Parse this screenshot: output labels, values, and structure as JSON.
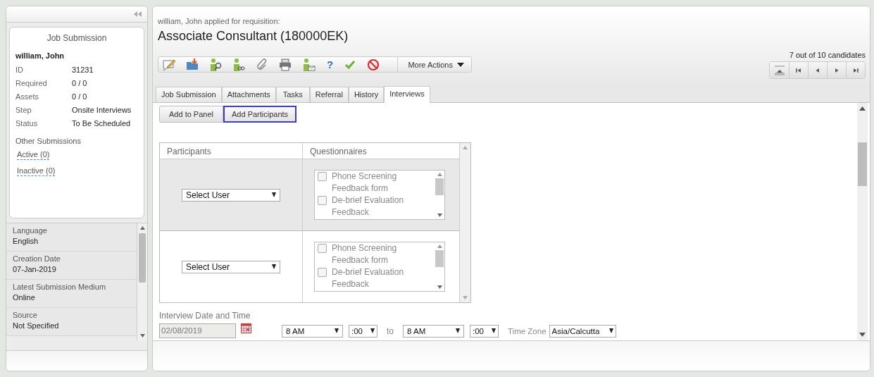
{
  "sidebar": {
    "card": {
      "title": "Job Submission",
      "candidate": "william, John",
      "fields": [
        {
          "label": "ID",
          "value": "31231"
        },
        {
          "label": "Required",
          "value": "0 / 0"
        },
        {
          "label": "Assets",
          "value": "0 / 0"
        },
        {
          "label": "Step",
          "value": "Onsite Interviews"
        },
        {
          "label": "Status",
          "value": "To Be Scheduled"
        }
      ],
      "other_title": "Other Submissions",
      "links": [
        "Active (0)",
        "Inactive (0)"
      ]
    },
    "details": [
      {
        "label": "Language",
        "value": "English"
      },
      {
        "label": "Creation Date",
        "value": "07-Jan-2019"
      },
      {
        "label": "Latest Submission Medium",
        "value": "Online"
      },
      {
        "label": "Source",
        "value": "Not Specified"
      }
    ]
  },
  "header": {
    "subtitle": "william, John applied for requisition:",
    "title": "Associate Consultant (180000EK)",
    "count": "7 out of 10 candidates"
  },
  "toolbar": {
    "help_glyph": "?",
    "more_actions": "More Actions"
  },
  "tabs": [
    {
      "label": "Job Submission",
      "selected": false
    },
    {
      "label": "Attachments",
      "selected": false
    },
    {
      "label": "Tasks",
      "selected": false
    },
    {
      "label": "Referral",
      "selected": false
    },
    {
      "label": "History",
      "selected": false
    },
    {
      "label": "Interviews",
      "selected": true
    }
  ],
  "action_buttons": [
    {
      "label": "Add to Panel",
      "focused": false
    },
    {
      "label": "Add Participants",
      "focused": true
    }
  ],
  "table": {
    "columns": [
      "Participants",
      "Questionnaires"
    ],
    "rows": [
      {
        "select": "Select User",
        "options": [
          {
            "label": "Phone Screening Feedback form",
            "checked": false
          },
          {
            "label": "De-brief Evaluation Feedback",
            "checked": false
          }
        ]
      },
      {
        "select": "Select User",
        "options": [
          {
            "label": "Phone Screening Feedback form",
            "checked": false
          },
          {
            "label": "De-brief Evaluation Feedback",
            "checked": false
          }
        ]
      }
    ]
  },
  "schedule": {
    "label": "Interview Date and Time",
    "date": "02/08/2019",
    "start_hour": "8 AM",
    "start_minute": ":00",
    "to": "to",
    "end_hour": "8 AM",
    "end_minute": ":00",
    "timezone_label": "Time Zone",
    "timezone": "Asia/Calcutta"
  }
}
